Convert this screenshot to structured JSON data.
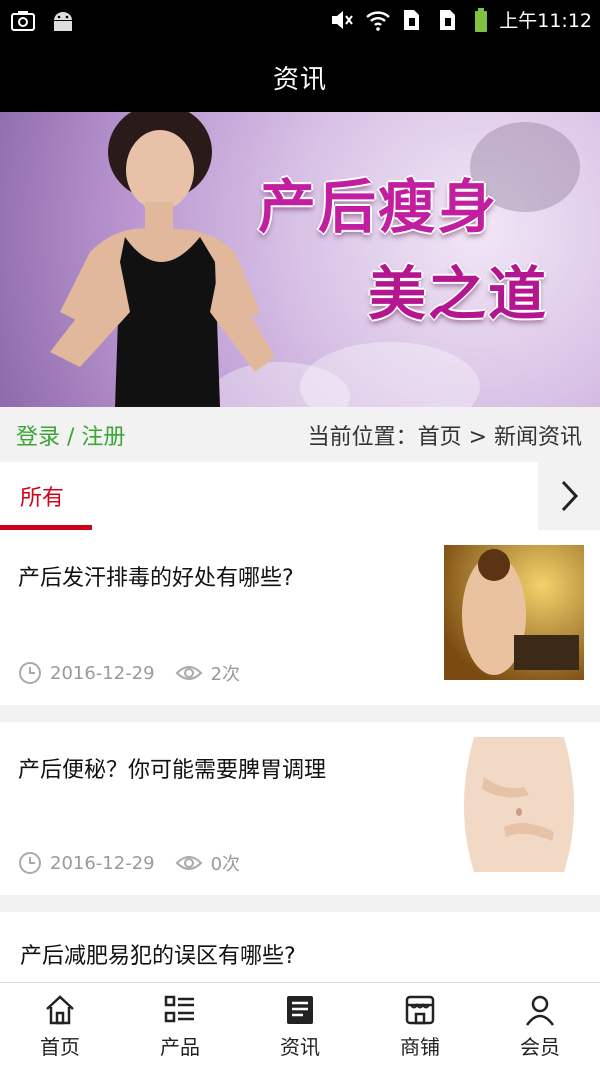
{
  "status_bar": {
    "time": "上午11:12"
  },
  "header": {
    "title": "资讯"
  },
  "banner": {
    "line1": "产后瘦身",
    "line2": "美之道"
  },
  "nav_row": {
    "login": "登录 / 注册",
    "breadcrumb": "当前位置：首页 > 新闻资讯"
  },
  "tabs": [
    {
      "label": "所有",
      "active": true
    }
  ],
  "news": [
    {
      "title": "产后发汗排毒的好处有哪些?",
      "date": "2016-12-29",
      "views": "2次"
    },
    {
      "title": "产后便秘？你可能需要脾胃调理",
      "date": "2016-12-29",
      "views": "0次"
    },
    {
      "title": "产后减肥易犯的误区有哪些?"
    }
  ],
  "bottom_nav": [
    {
      "label": "首页",
      "icon": "home-icon"
    },
    {
      "label": "产品",
      "icon": "list-icon"
    },
    {
      "label": "资讯",
      "icon": "news-icon"
    },
    {
      "label": "商铺",
      "icon": "shop-icon"
    },
    {
      "label": "会员",
      "icon": "user-icon"
    }
  ],
  "colors": {
    "accent": "#d0021b",
    "login_green": "#3aa635"
  }
}
